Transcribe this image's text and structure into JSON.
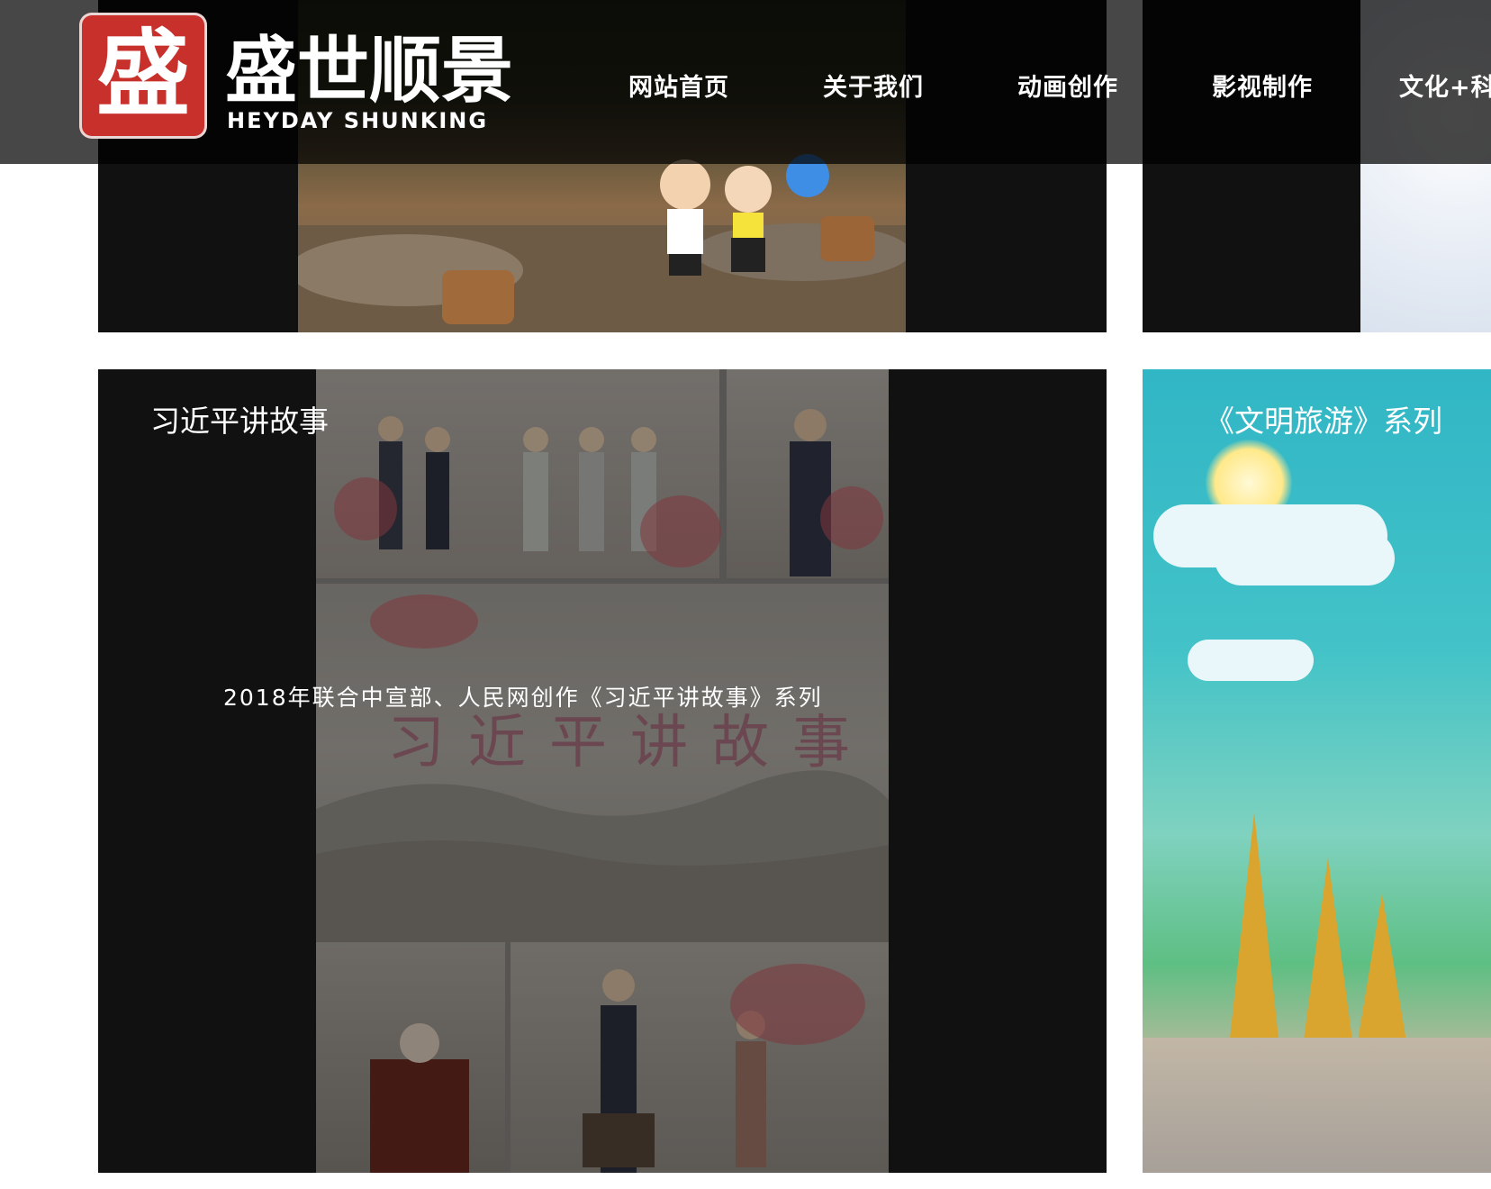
{
  "logo": {
    "mark": "盛",
    "name_cn": "盛世顺景",
    "name_en": "HEYDAY SHUNKING"
  },
  "nav": {
    "items": [
      {
        "label": "网站首页"
      },
      {
        "label": "关于我们"
      },
      {
        "label": "动画创作"
      },
      {
        "label": "影视制作"
      },
      {
        "label": "文化+科"
      }
    ]
  },
  "cards": {
    "xi_stories": {
      "title": "习近平讲故事",
      "subtitle": "2018年联合中宣部、人民网创作《习近平讲故事》系列",
      "image_text": "习近平讲故事"
    },
    "civilized_tourism": {
      "title": "《文明旅游》系列"
    }
  },
  "colors": {
    "brand_red": "#c8302c",
    "header_bg": "rgba(0,0,0,0.72)",
    "card_bg": "#111111",
    "text": "#ffffff"
  }
}
